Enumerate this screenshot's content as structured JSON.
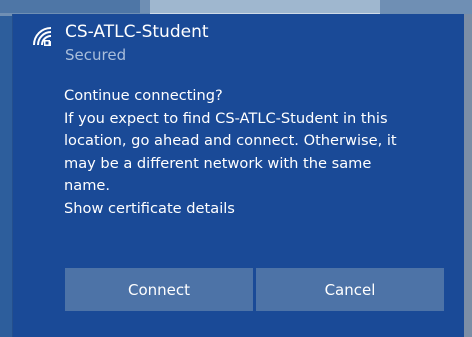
{
  "network": {
    "name": "CS-ATLC-Student",
    "status": "Secured",
    "icon": "wifi-secured-icon"
  },
  "message": {
    "heading": "Continue connecting?",
    "lines": [
      "If you expect to find CS-ATLC-Student in this",
      "location, go ahead and connect. Otherwise, it",
      "may be a different network with the same",
      "name."
    ],
    "link": "Show certificate details"
  },
  "buttons": {
    "connect": "Connect",
    "cancel": "Cancel"
  },
  "colors": {
    "panel": "#1a4a97",
    "button": "#4d73a7",
    "text": "#ffffff",
    "secondary_text": "#a9bedb"
  }
}
